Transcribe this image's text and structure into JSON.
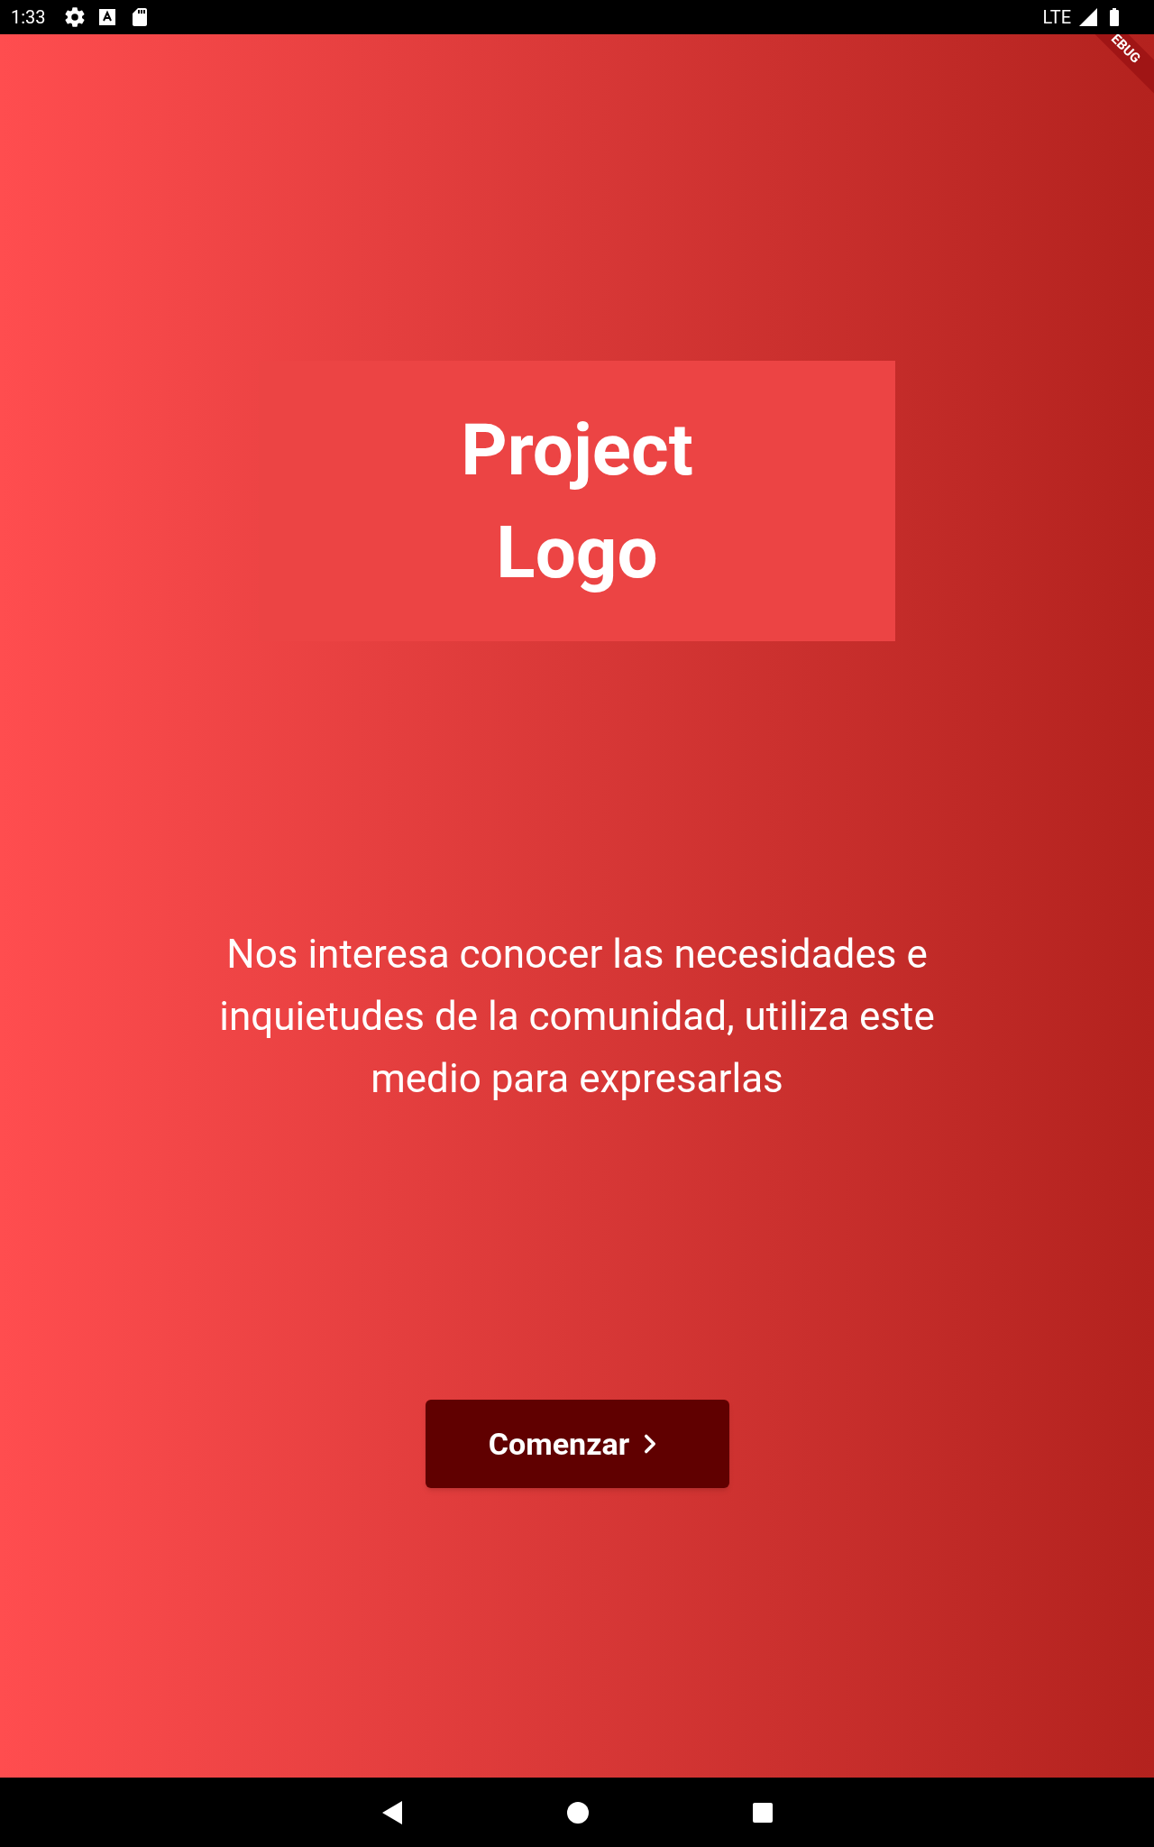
{
  "status_bar": {
    "time": "1:33",
    "network": "LTE"
  },
  "debug_banner": "EBUG",
  "logo": {
    "lines": [
      "Project",
      "Logo"
    ]
  },
  "message": "Nos interesa conocer las necesidades e inquietudes de la comunidad, utiliza este medio para expresarlas",
  "start_button": {
    "label": "Comenzar"
  }
}
